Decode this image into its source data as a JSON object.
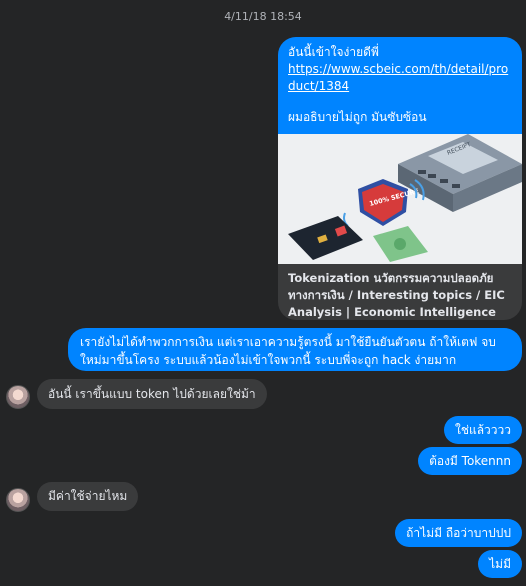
{
  "timestamp": "4/11/18 18:54",
  "card": {
    "message_line1": "อันนี้เข้าใจง่ายดีพี่",
    "link": "https://www.scbeic.com/th/detail/product/1384",
    "message_line2": "ผมอธิบายไม่ถูก มันซับซ้อน",
    "title": "Tokenization นวัตกรรมความปลอดภัยทางการเงิน / Interesting topics / EIC Analysis | Economic Intelligence Center ...",
    "image_badge": "100% SECURE",
    "image_receipt": "RECEIPT"
  },
  "messages": {
    "m1": "เรายังไม่ได้ทำพวกการเงิน แต่เราเอาความรู้ตรงนี้ มาใช้ยืนยันตัวตน ถ้าให้เตฟ จบใหม่มาขึ้นโครง ระบบแล้วน้องไม่เข้าใจพวกนี้ ระบบพี่จะถูก hack ง่ายมาก",
    "m2": "อันนี้ เราขึ้นแบบ token ไปด้วยเลยใช่ม้า",
    "m3": "ใช่แล้วววว",
    "m4": "ต้องมี Tokennn",
    "m5": "มีค่าใช้จ่ายไหม",
    "m6": "ถ้าไม่มี ถือว่าบาปปป",
    "m7": "ไม่มี"
  },
  "colors": {
    "outgoing": "#0084ff",
    "incoming": "#3a3b3c",
    "background": "#242526"
  }
}
